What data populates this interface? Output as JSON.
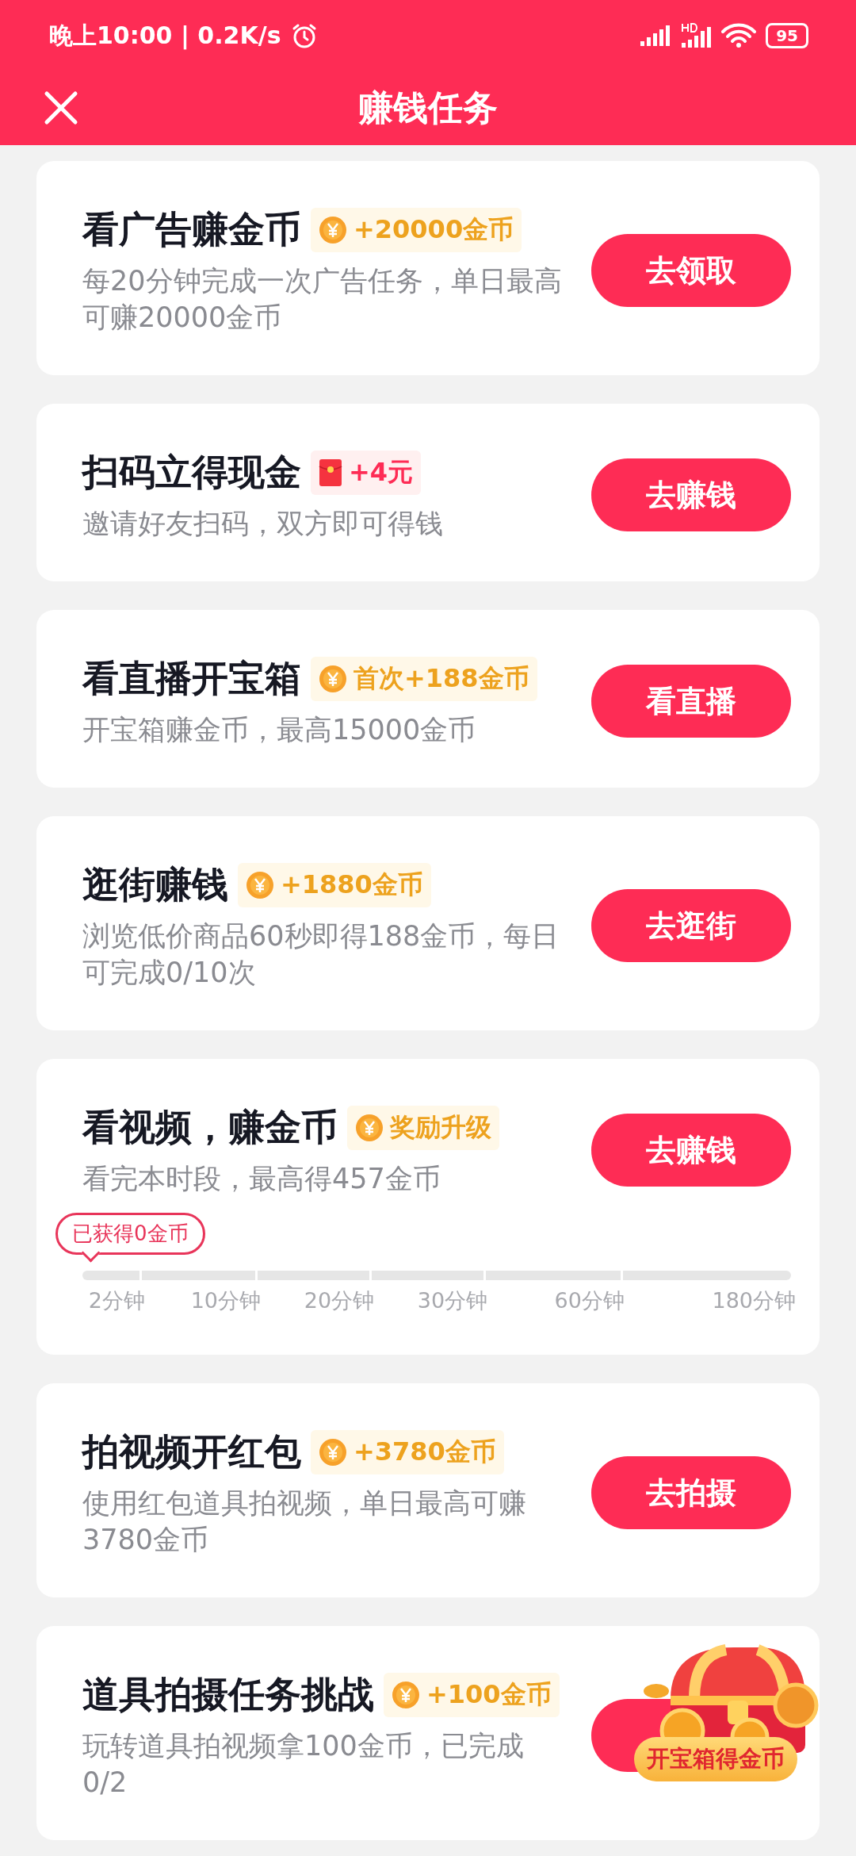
{
  "status_bar": {
    "time": "晚上10:00 | 0.2K/s",
    "battery": "95"
  },
  "header": {
    "title": "赚钱任务"
  },
  "tasks": [
    {
      "kind": "plain",
      "title": "看广告赚金币",
      "badge": {
        "kind": "coin",
        "text": "+20000金币"
      },
      "description": "每20分钟完成一次广告任务，单日最高可赚20000金币",
      "button": "去领取"
    },
    {
      "kind": "plain",
      "title": "扫码立得现金",
      "badge": {
        "kind": "envelope",
        "text": "+4元"
      },
      "description": "邀请好友扫码，双方即可得钱",
      "button": "去赚钱"
    },
    {
      "kind": "plain",
      "title": "看直播开宝箱",
      "badge": {
        "kind": "coin",
        "text": "首次+188金币"
      },
      "description": "开宝箱赚金币，最高15000金币",
      "button": "看直播"
    },
    {
      "kind": "plain",
      "title": "逛街赚钱",
      "badge": {
        "kind": "coin",
        "text": "+1880金币"
      },
      "description": "浏览低价商品60秒即得188金币，每日可完成0/10次",
      "button": "去逛街"
    },
    {
      "kind": "progress",
      "title": "看视频，赚金币",
      "badge": {
        "kind": "coin",
        "text": "奖励升级"
      },
      "description": "看完本时段，最高得457金币",
      "button": "去赚钱",
      "earned": "已获得0金币",
      "steps": [
        "2分钟",
        "10分钟",
        "20分钟",
        "30分钟",
        "60分钟",
        "180分钟"
      ]
    },
    {
      "kind": "plain",
      "title": "拍视频开红包",
      "badge": {
        "kind": "coin",
        "text": "+3780金币"
      },
      "description": "使用红包道具拍视频，单日最高可赚3780金币",
      "button": "去拍摄"
    },
    {
      "kind": "plain",
      "title": "道具拍摄任务挑战",
      "badge": {
        "kind": "coin",
        "text": "+100金币"
      },
      "description": "玩转道具拍视频拿100金币，已完成0/2"
    }
  ],
  "floating": {
    "label": "开宝箱得金币"
  }
}
